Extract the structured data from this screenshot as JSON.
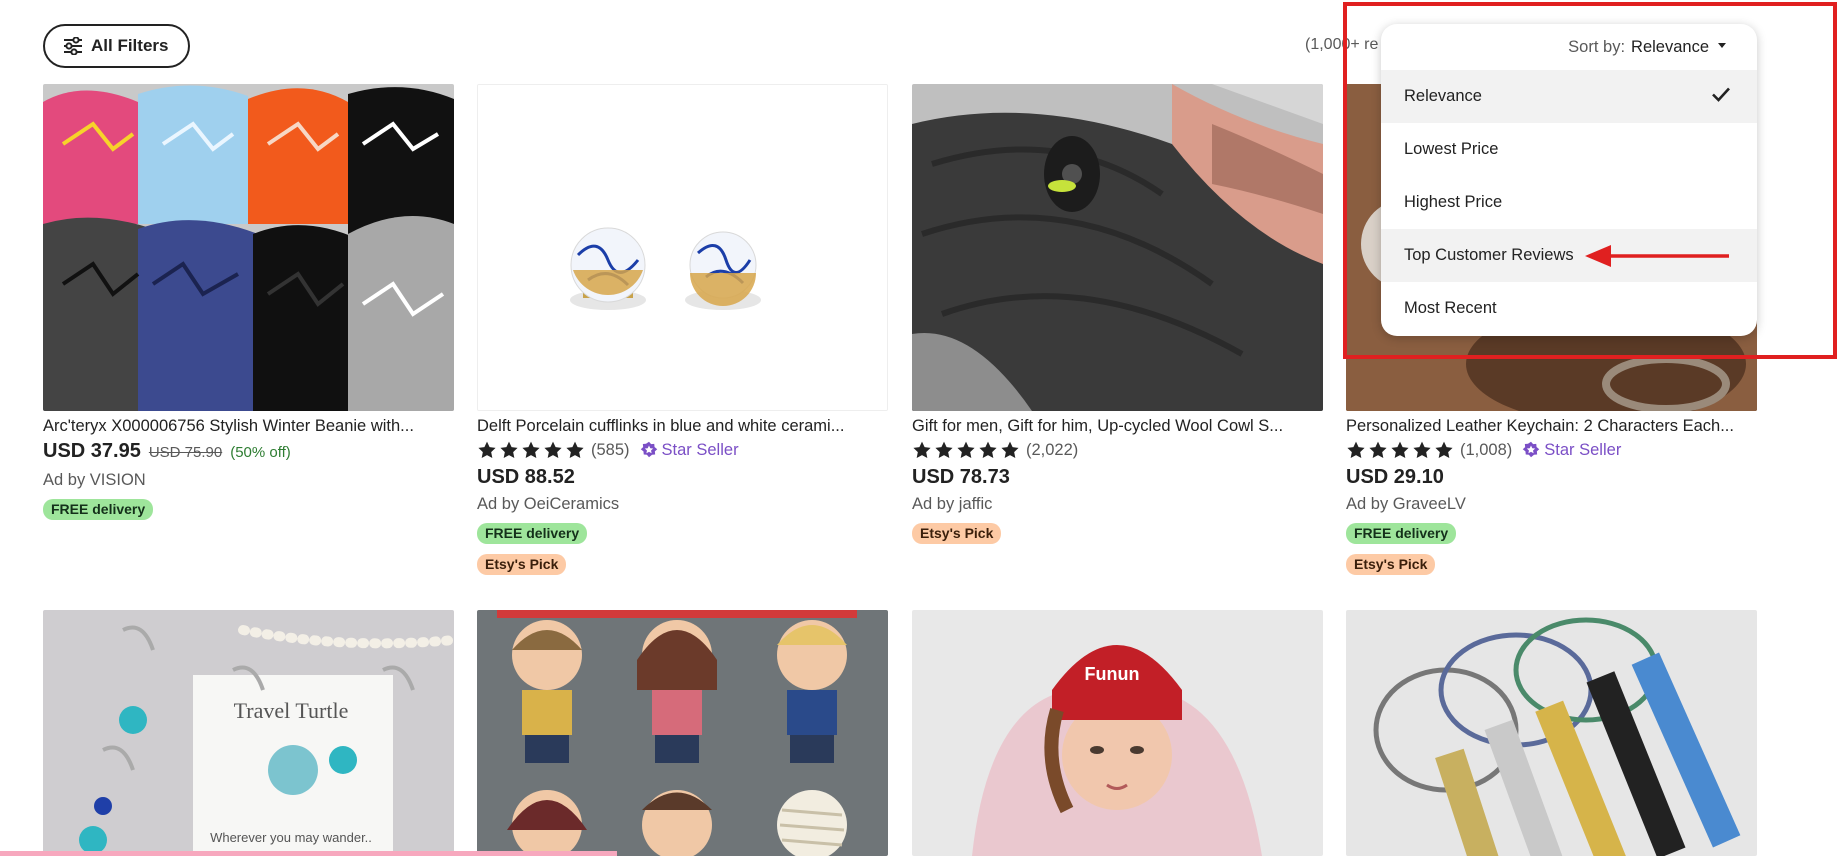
{
  "toolbar": {
    "filters_label": "All Filters",
    "result_count": "(1,000+ re"
  },
  "sort": {
    "prefix": "Sort by:",
    "current": "Relevance",
    "options": [
      {
        "label": "Relevance",
        "selected": true
      },
      {
        "label": "Lowest Price",
        "selected": false
      },
      {
        "label": "Highest Price",
        "selected": false
      },
      {
        "label": "Top Customer Reviews",
        "selected": false,
        "annotated": true
      },
      {
        "label": "Most Recent",
        "selected": false
      }
    ],
    "annotation_color": "#e02020"
  },
  "listings": [
    {
      "title": "Arc'teryx X000006756 Stylish Winter Beanie with...",
      "price": "USD 37.95",
      "original_price": "USD 75.90",
      "discount": "(50% off)",
      "shop": "Ad by VISION",
      "badges": [
        "FREE delivery"
      ]
    },
    {
      "title": "Delft Porcelain cufflinks in blue and white cerami...",
      "rating_stars": 5,
      "reviews": "(585)",
      "star_seller": "Star Seller",
      "price": "USD 88.52",
      "shop": "Ad by OeiCeramics",
      "badges": [
        "FREE delivery",
        "Etsy's Pick"
      ]
    },
    {
      "title": "Gift for men, Gift for him, Up-cycled Wool Cowl S...",
      "rating_stars": 5,
      "reviews": "(2,022)",
      "price": "USD 78.73",
      "shop": "Ad by jaffic",
      "badges": [
        "Etsy's Pick"
      ]
    },
    {
      "title": "Personalized Leather Keychain: 2 Characters Each...",
      "rating_stars": 5,
      "reviews": "(1,008)",
      "star_seller": "Star Seller",
      "price": "USD 29.10",
      "shop": "Ad by GraveeLV",
      "badges": [
        "FREE delivery",
        "Etsy's Pick"
      ]
    }
  ],
  "second_row_images": [
    {
      "caption_line1": "Travel Turtle",
      "caption_line2": "Wherever you may wander.."
    },
    {
      "caption_line1": ""
    },
    {
      "caption_line1": "Funun"
    },
    {
      "caption_line1": ""
    }
  ]
}
